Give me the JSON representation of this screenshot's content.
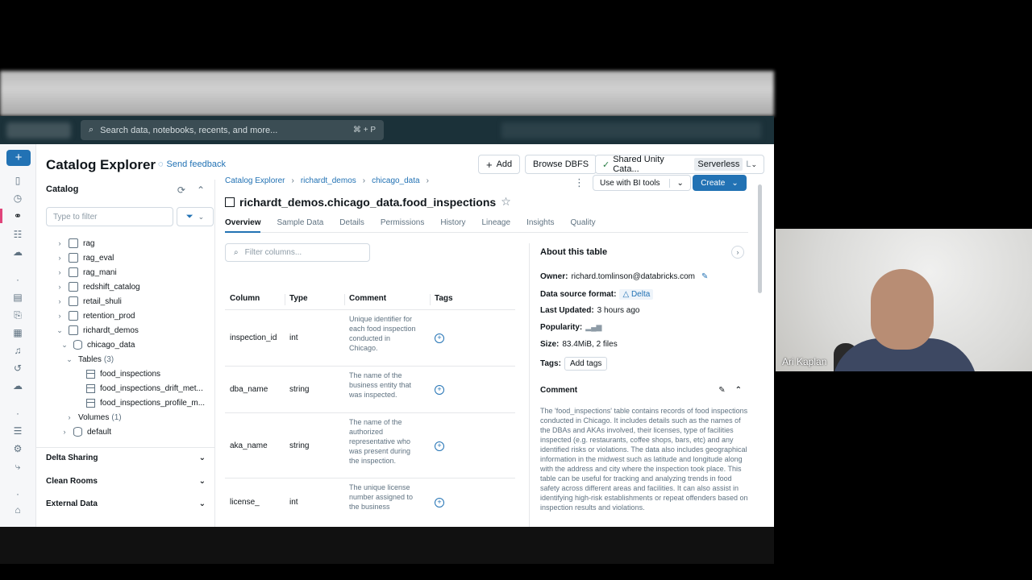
{
  "topbar": {
    "search_placeholder": "Search data, notebooks, recents, and more...",
    "search_shortcut": "⌘ + P"
  },
  "header": {
    "title": "Catalog Explorer",
    "feedback": "Send feedback",
    "add": "Add",
    "browse": "Browse DBFS",
    "compute_name": "Shared Unity Cata...",
    "compute_type": "Serverless",
    "compute_extra": "L"
  },
  "catalog": {
    "heading": "Catalog",
    "filter_placeholder": "Type to filter",
    "items": [
      "rag",
      "rag_eval",
      "rag_mani",
      "redshift_catalog",
      "retail_shuli",
      "retention_prod",
      "richardt_demos"
    ],
    "schema": "chicago_data",
    "tables_label": "Tables",
    "tables_count": "(3)",
    "tables": [
      "food_inspections",
      "food_inspections_drift_met...",
      "food_inspections_profile_m..."
    ],
    "volumes_label": "Volumes",
    "volumes_count": "(1)",
    "default_schema": "default",
    "sections": [
      "Delta Sharing",
      "Clean Rooms",
      "External Data"
    ]
  },
  "main": {
    "breadcrumb": [
      "Catalog Explorer",
      "richardt_demos",
      "chicago_data"
    ],
    "bi_tools": "Use with BI tools",
    "create": "Create",
    "table_name": "richardt_demos.chicago_data.food_inspections",
    "tabs": [
      "Overview",
      "Sample Data",
      "Details",
      "Permissions",
      "History",
      "Lineage",
      "Insights",
      "Quality"
    ],
    "filter_columns": "Filter columns...",
    "col_headers": [
      "Column",
      "Type",
      "Comment",
      "Tags"
    ],
    "rows": [
      {
        "name": "inspection_id",
        "type": "int",
        "comment": "Unique identifier for each food inspection conducted in Chicago."
      },
      {
        "name": "dba_name",
        "type": "string",
        "comment": "The name of the business entity that was inspected."
      },
      {
        "name": "aka_name",
        "type": "string",
        "comment": "The name of the authorized representative who was present during the inspection."
      },
      {
        "name": "license_",
        "type": "int",
        "comment": "The unique license number assigned to the business"
      }
    ]
  },
  "about": {
    "title": "About this table",
    "owner_label": "Owner:",
    "owner": "richard.tomlinson@databricks.com",
    "format_label": "Data source format:",
    "format": "Delta",
    "updated_label": "Last Updated:",
    "updated": "3 hours ago",
    "popularity_label": "Popularity:",
    "size_label": "Size:",
    "size": "83.4MiB, 2 files",
    "tags_label": "Tags:",
    "add_tags": "Add tags",
    "comment_title": "Comment",
    "comment": "The 'food_inspections' table contains records of food inspections conducted in Chicago. It includes details such as the names of the DBAs and AKAs involved, their licenses, type of facilities inspected (e.g. restaurants, coffee shops, bars, etc) and any identified risks or violations. The data also includes geographical information in the midwest such as latitude and longitude along with the address and city where the inspection took place. This table can be useful for tracking and analyzing trends in food safety across different areas and facilities. It can also assist in identifying high-risk establishments or repeat offenders based on inspection results and violations."
  },
  "video": {
    "participant": "Ari Kaplan"
  }
}
